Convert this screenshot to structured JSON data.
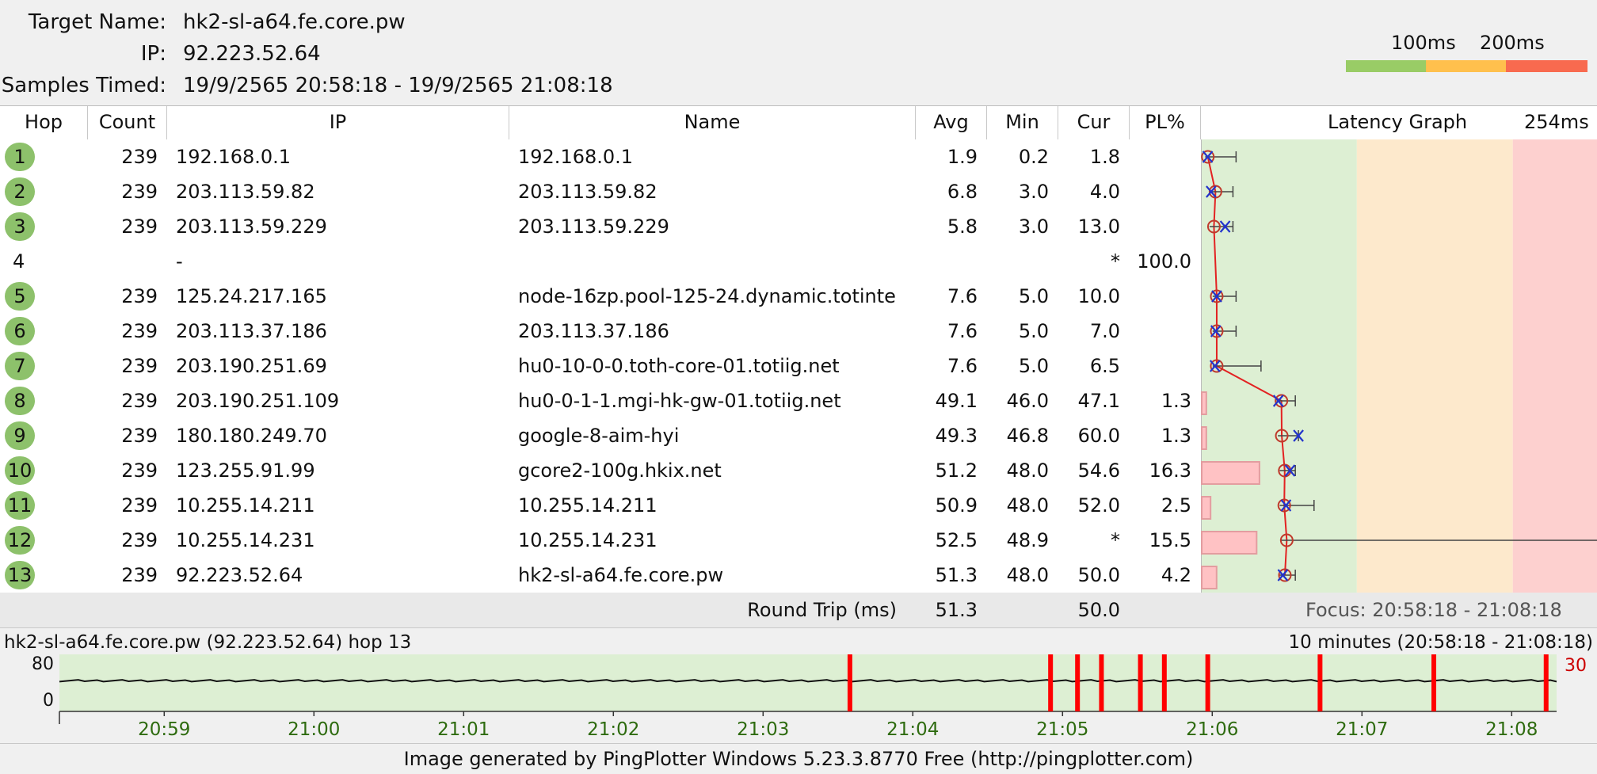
{
  "header": {
    "target_name_label": "Target Name:",
    "target_name": "hk2-sl-a64.fe.core.pw",
    "ip_label": "IP:",
    "ip": "92.223.52.64",
    "samples_label": "Samples Timed:",
    "samples": "19/9/2565 20:58:18 - 19/9/2565 21:08:18"
  },
  "legend": {
    "label_100": "100ms",
    "label_200": "200ms",
    "colors": {
      "good": "#99cc66",
      "warn": "#ffc04d",
      "bad": "#f86a4f"
    }
  },
  "columns": {
    "hop": "Hop",
    "count": "Count",
    "ip": "IP",
    "name": "Name",
    "avg": "Avg",
    "min": "Min",
    "cur": "Cur",
    "pl": "PL%",
    "graph": "Latency Graph",
    "graph_max": "254ms"
  },
  "hops": [
    {
      "hop": "1",
      "count": "239",
      "ip": "192.168.0.1",
      "name": "192.168.0.1",
      "avg": "1.9",
      "min": "0.2",
      "cur": "1.8",
      "pl": "",
      "badge": true,
      "avg_ms": 1.9,
      "min_ms": 0.2,
      "cur_ms": 1.8,
      "max_ms": 20,
      "pl_pct": 0
    },
    {
      "hop": "2",
      "count": "239",
      "ip": "203.113.59.82",
      "name": "203.113.59.82",
      "avg": "6.8",
      "min": "3.0",
      "cur": "4.0",
      "pl": "",
      "badge": true,
      "avg_ms": 6.8,
      "min_ms": 3.0,
      "cur_ms": 4.0,
      "max_ms": 18,
      "pl_pct": 0
    },
    {
      "hop": "3",
      "count": "239",
      "ip": "203.113.59.229",
      "name": "203.113.59.229",
      "avg": "5.8",
      "min": "3.0",
      "cur": "13.0",
      "pl": "",
      "badge": true,
      "avg_ms": 5.8,
      "min_ms": 3.0,
      "cur_ms": 13.0,
      "max_ms": 18,
      "pl_pct": 0
    },
    {
      "hop": "4",
      "count": "",
      "ip": "-",
      "name": "",
      "avg": "",
      "min": "",
      "cur": "*",
      "pl": "100.0",
      "badge": false
    },
    {
      "hop": "5",
      "count": "239",
      "ip": "125.24.217.165",
      "name": "node-16zp.pool-125-24.dynamic.totinte",
      "avg": "7.6",
      "min": "5.0",
      "cur": "10.0",
      "pl": "",
      "badge": true,
      "avg_ms": 7.6,
      "min_ms": 5.0,
      "cur_ms": 7.6,
      "max_ms": 20,
      "pl_pct": 0
    },
    {
      "hop": "6",
      "count": "239",
      "ip": "203.113.37.186",
      "name": "203.113.37.186",
      "avg": "7.6",
      "min": "5.0",
      "cur": "7.0",
      "pl": "",
      "badge": true,
      "avg_ms": 7.6,
      "min_ms": 5.0,
      "cur_ms": 7.0,
      "max_ms": 20,
      "pl_pct": 0
    },
    {
      "hop": "7",
      "count": "239",
      "ip": "203.190.251.69",
      "name": "hu0-10-0-0.toth-core-01.totiig.net",
      "avg": "7.6",
      "min": "5.0",
      "cur": "6.5",
      "pl": "",
      "badge": true,
      "avg_ms": 7.6,
      "min_ms": 5.0,
      "cur_ms": 6.5,
      "max_ms": 36,
      "pl_pct": 0
    },
    {
      "hop": "8",
      "count": "239",
      "ip": "203.190.251.109",
      "name": "hu0-0-1-1.mgi-hk-gw-01.totiig.net",
      "avg": "49.1",
      "min": "46.0",
      "cur": "47.1",
      "pl": "1.3",
      "badge": true,
      "avg_ms": 49.1,
      "min_ms": 46.0,
      "cur_ms": 47.1,
      "max_ms": 58,
      "pl_pct": 1.3
    },
    {
      "hop": "9",
      "count": "239",
      "ip": "180.180.249.70",
      "name": "google-8-aim-hyi",
      "avg": "49.3",
      "min": "46.8",
      "cur": "60.0",
      "pl": "1.3",
      "badge": true,
      "avg_ms": 49.3,
      "min_ms": 46.8,
      "cur_ms": 60.0,
      "max_ms": 60,
      "pl_pct": 1.3
    },
    {
      "hop": "10",
      "count": "239",
      "ip": "123.255.91.99",
      "name": "gcore2-100g.hkix.net",
      "avg": "51.2",
      "min": "48.0",
      "cur": "54.6",
      "pl": "16.3",
      "badge": true,
      "avg_ms": 51.2,
      "min_ms": 48.0,
      "cur_ms": 54.6,
      "max_ms": 58,
      "pl_pct": 16.3
    },
    {
      "hop": "11",
      "count": "239",
      "ip": "10.255.14.211",
      "name": "10.255.14.211",
      "avg": "50.9",
      "min": "48.0",
      "cur": "52.0",
      "pl": "2.5",
      "badge": true,
      "avg_ms": 50.9,
      "min_ms": 48.0,
      "cur_ms": 52.0,
      "max_ms": 70,
      "pl_pct": 2.5
    },
    {
      "hop": "12",
      "count": "239",
      "ip": "10.255.14.231",
      "name": "10.255.14.231",
      "avg": "52.5",
      "min": "48.9",
      "cur": "*",
      "pl": "15.5",
      "badge": true,
      "avg_ms": 52.5,
      "min_ms": 48.9,
      "cur_ms": null,
      "max_ms": 252,
      "pl_pct": 15.5
    },
    {
      "hop": "13",
      "count": "239",
      "ip": "92.223.52.64",
      "name": "hk2-sl-a64.fe.core.pw",
      "avg": "51.3",
      "min": "48.0",
      "cur": "50.0",
      "pl": "4.2",
      "badge": true,
      "avg_ms": 51.3,
      "min_ms": 48.0,
      "cur_ms": 50.0,
      "max_ms": 58,
      "pl_pct": 4.2
    }
  ],
  "footer": {
    "round_trip_label": "Round Trip (ms)",
    "avg": "51.3",
    "cur": "50.0",
    "focus": "Focus: 20:58:18 - 21:08:18"
  },
  "timeline": {
    "title": "hk2-sl-a64.fe.core.pw (92.223.52.64) hop 13",
    "range": "10 minutes (20:58:18 - 21:08:18)",
    "y_top": "80",
    "y_bottom": "0",
    "y_right": "30",
    "ticks": [
      "20:59",
      "21:00",
      "21:01",
      "21:02",
      "21:03",
      "21:04",
      "21:05",
      "21:06",
      "21:07",
      "21:08"
    ],
    "loss_markers_min": [
      5.28,
      6.62,
      6.8,
      6.96,
      7.22,
      7.38,
      7.67,
      8.42,
      9.18,
      9.93
    ],
    "latency_ms": 50
  },
  "credit": "Image generated by PingPlotter Windows 5.23.3.8770 Free (http://pingplotter.com)"
}
